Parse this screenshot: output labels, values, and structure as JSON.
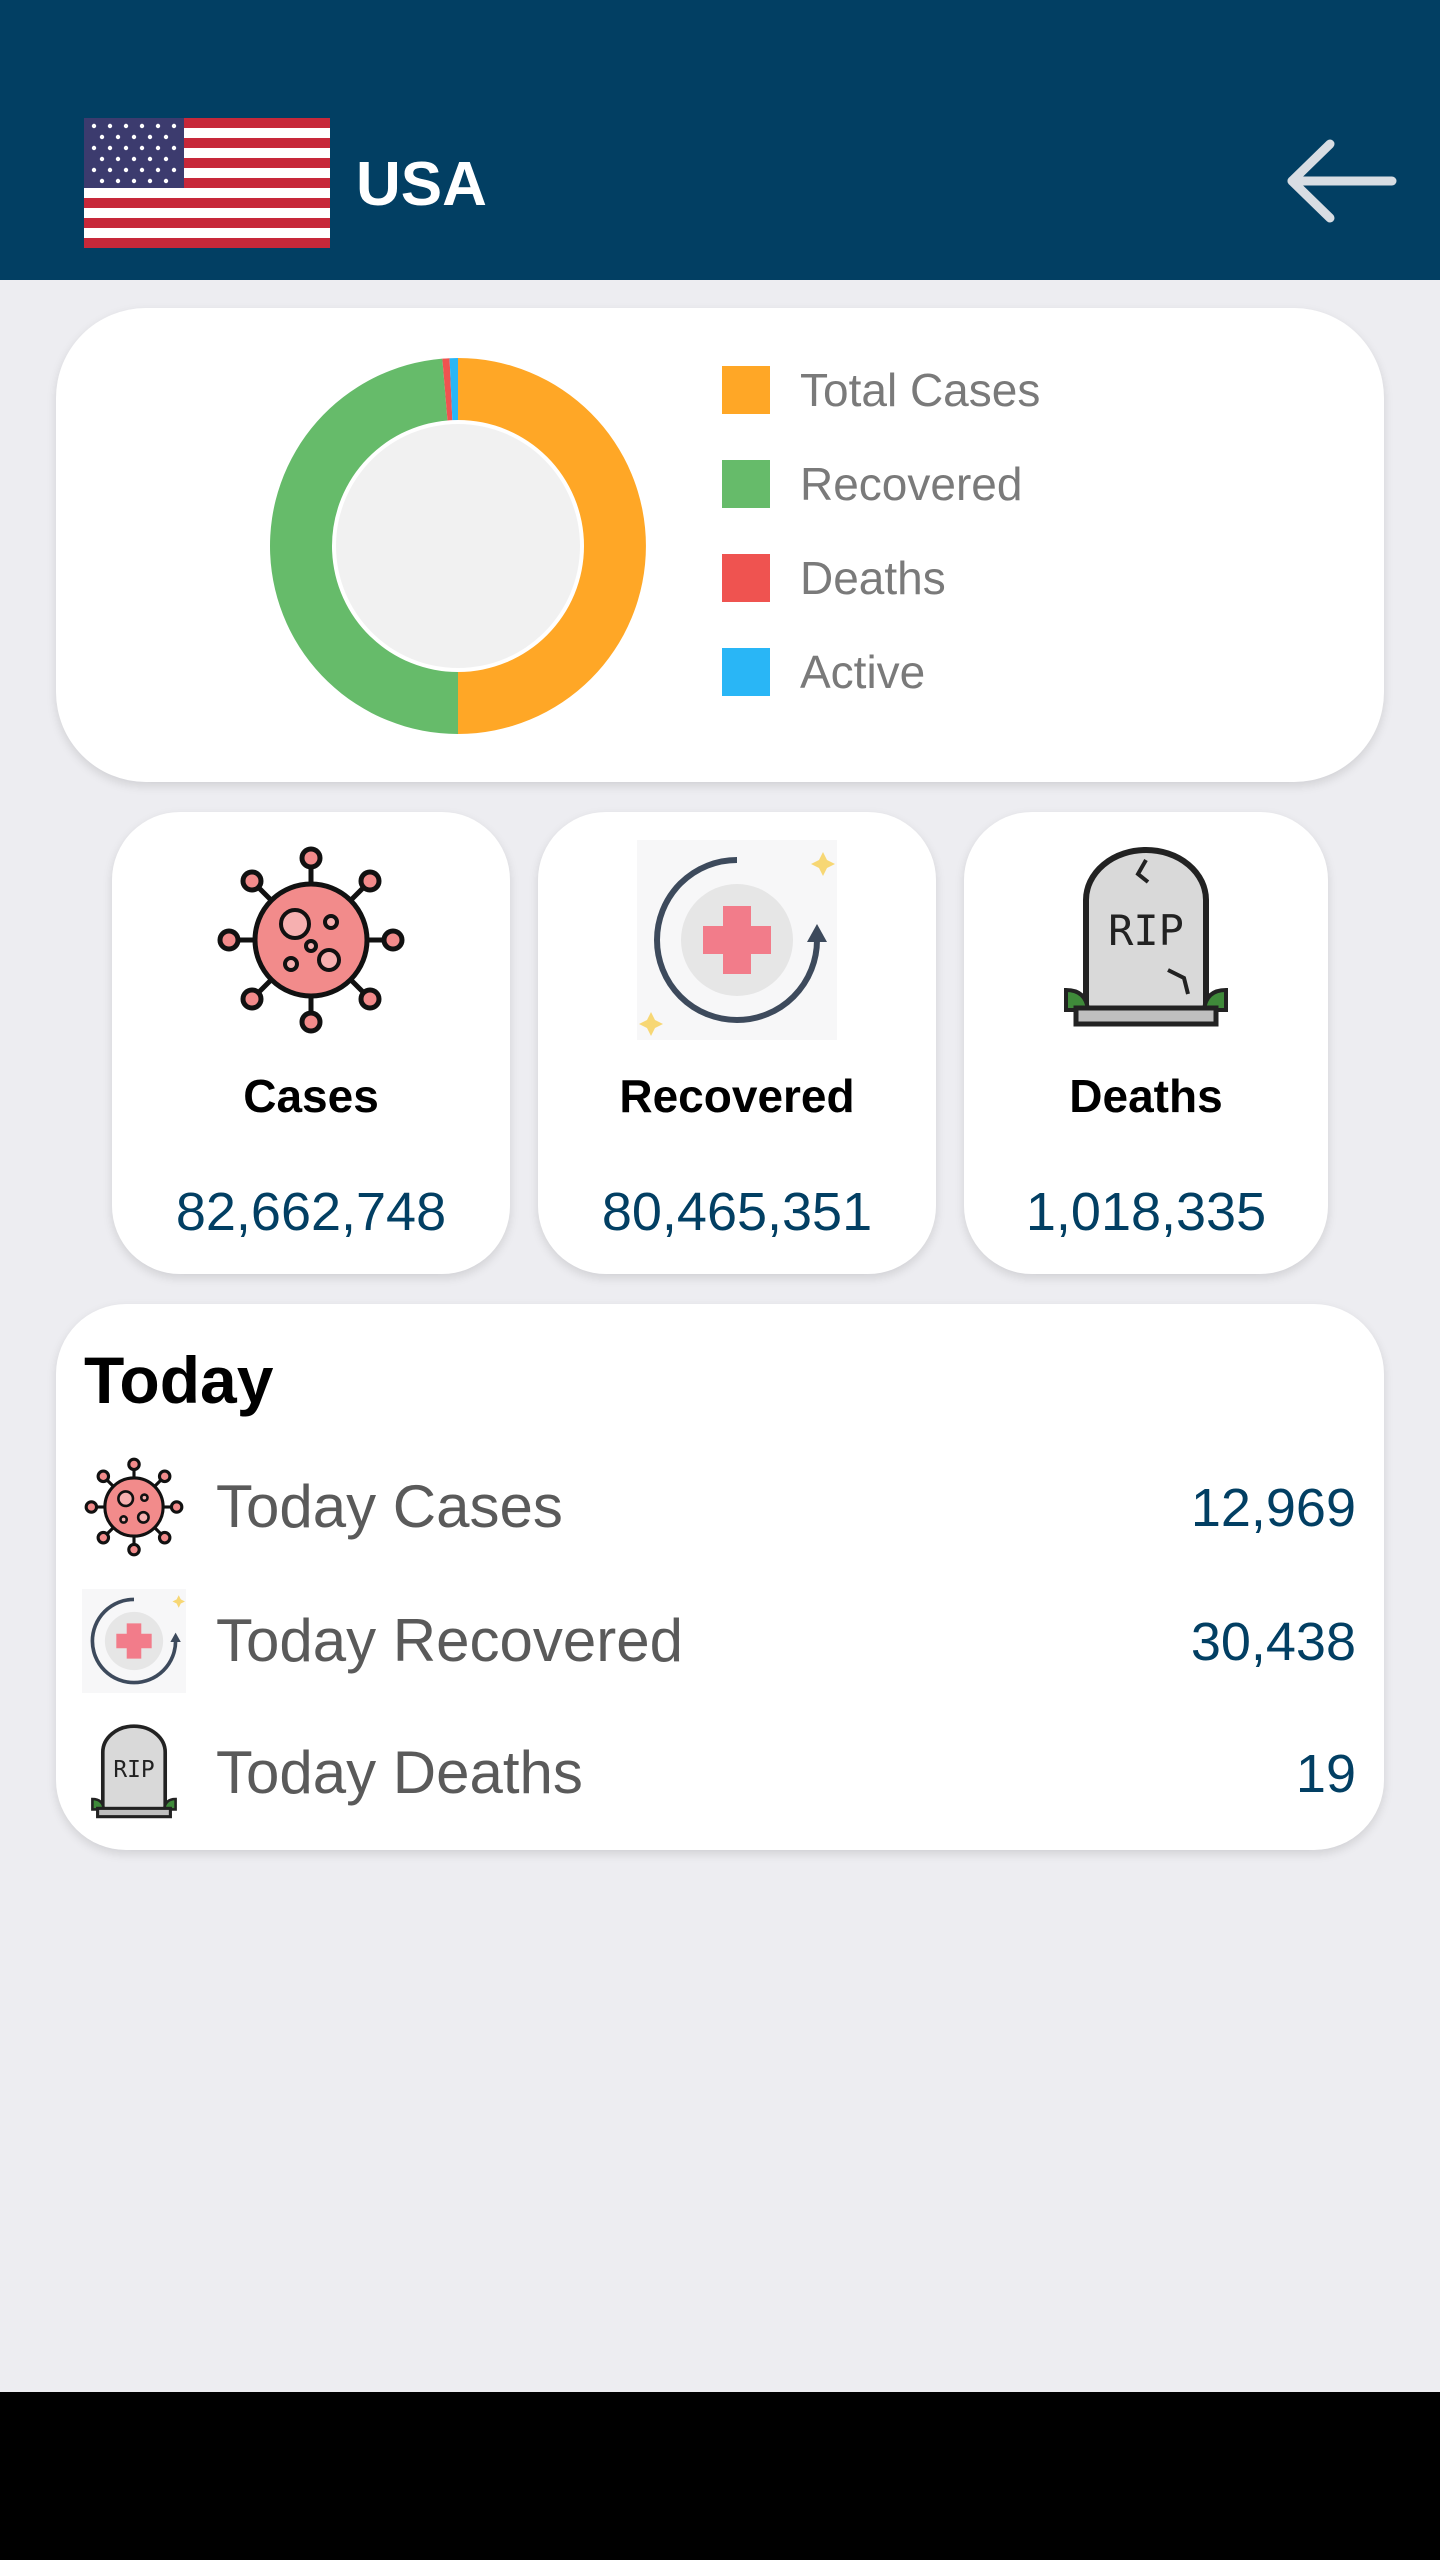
{
  "header": {
    "country": "USA",
    "flag_icon": "us-flag-icon",
    "back_icon": "arrow-left-icon",
    "bg_color": "#023f63"
  },
  "chart_data": {
    "type": "pie",
    "legend_position": "right",
    "categories": [
      "Total Cases",
      "Recovered",
      "Deaths",
      "Active"
    ],
    "values": [
      82662748,
      80465351,
      1018335,
      1179062
    ],
    "colors": [
      "#ffa726",
      "#66bb6a",
      "#ef5350",
      "#29b6f6"
    ]
  },
  "stats": [
    {
      "title": "Cases",
      "value": "82,662,748",
      "icon": "virus-icon"
    },
    {
      "title": "Recovered",
      "value": "80,465,351",
      "icon": "medical-cross-icon"
    },
    {
      "title": "Deaths",
      "value": "1,018,335",
      "icon": "tombstone-icon"
    }
  ],
  "today": {
    "title": "Today",
    "rows": [
      {
        "label": "Today Cases",
        "value": "12,969",
        "icon": "virus-icon"
      },
      {
        "label": "Today Recovered",
        "value": "30,438",
        "icon": "medical-cross-icon"
      },
      {
        "label": "Today Deaths",
        "value": "19",
        "icon": "tombstone-icon"
      }
    ]
  }
}
